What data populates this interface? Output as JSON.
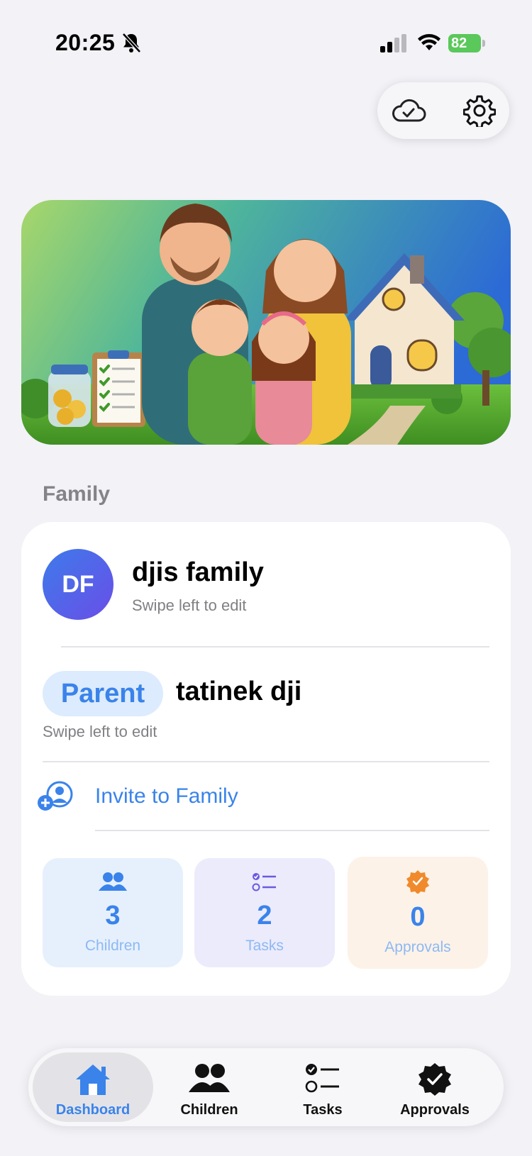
{
  "status_bar": {
    "time": "20:25",
    "battery": "82"
  },
  "top_actions": {
    "cloud_icon": "cloud-check-icon",
    "settings_icon": "gear-icon"
  },
  "section": {
    "family_label": "Family"
  },
  "family": {
    "initials": "DF",
    "name": "djis family",
    "swipe_hint": "Swipe left to edit"
  },
  "member": {
    "role": "Parent",
    "name": "tatinek dji",
    "swipe_hint": "Swipe left to edit"
  },
  "invite": {
    "label": "Invite to Family"
  },
  "stats": {
    "children": {
      "value": "3",
      "label": "Children"
    },
    "tasks": {
      "value": "2",
      "label": "Tasks"
    },
    "approvals": {
      "value": "0",
      "label": "Approvals"
    }
  },
  "tabs": [
    {
      "label": "Dashboard",
      "icon": "house-icon",
      "selected": true
    },
    {
      "label": "Children",
      "icon": "people-icon"
    },
    {
      "label": "Tasks",
      "icon": "checklist-icon"
    },
    {
      "label": "Approvals",
      "icon": "seal-check-icon"
    }
  ],
  "colors": {
    "accent": "#3a83ea",
    "background": "#f2f2f7",
    "approvals": "#f08a2c",
    "tasks": "#6a5ae0"
  }
}
